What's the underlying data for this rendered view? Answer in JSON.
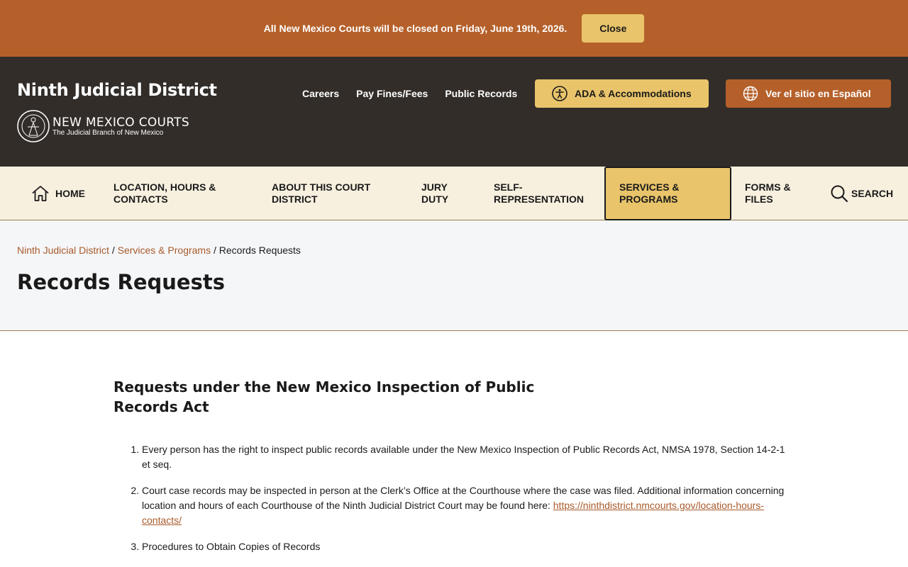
{
  "alert": {
    "message": "All New Mexico Courts will be closed on Friday, June 19th, 2026.",
    "close_label": "Close"
  },
  "header": {
    "site_title": "Ninth Judicial District",
    "logo_main": "NEW MEXICO COURTS",
    "logo_sub": "The Judicial Branch of New Mexico",
    "util_links": [
      "Careers",
      "Pay Fines/Fees",
      "Public Records"
    ],
    "ada_label": "ADA & Accommodations",
    "spanish_label": "Ver el sitio en Español"
  },
  "nav": {
    "home": "HOME",
    "location": "LOCATION, HOURS & CONTACTS",
    "about": "ABOUT THIS COURT DISTRICT",
    "jury": "JURY DUTY",
    "self_rep": "SELF-REPRESENTATION",
    "services": "SERVICES & PROGRAMS",
    "forms": "FORMS & FILES",
    "search": "SEARCH"
  },
  "breadcrumb": {
    "home": "Ninth Judicial District",
    "parent": "Services & Programs",
    "current": "Records Requests",
    "sep": "/"
  },
  "page_title": "Records Requests",
  "content": {
    "heading": "Requests under the New Mexico Inspection of Public Records Act",
    "item1": "Every person has the right to inspect public records available under the New Mexico Inspection of Public Records Act, NMSA 1978, Section 14-2-1 et seq.",
    "item2_text": "Court case records may be inspected in person at the Clerk’s Office at the Courthouse where the case was filed.  Additional information concerning location and hours of each Courthouse of the Ninth Judicial District Court may be found here: ",
    "item2_link": "https://ninthdistrict.nmcourts.gov/location-hours-contacts/",
    "item3": "Procedures to Obtain Copies of Records"
  },
  "colors": {
    "accent": "#b5602a",
    "gold": "#e9c46a",
    "header_bg": "#322d29",
    "nav_bg": "#f8f0df"
  }
}
